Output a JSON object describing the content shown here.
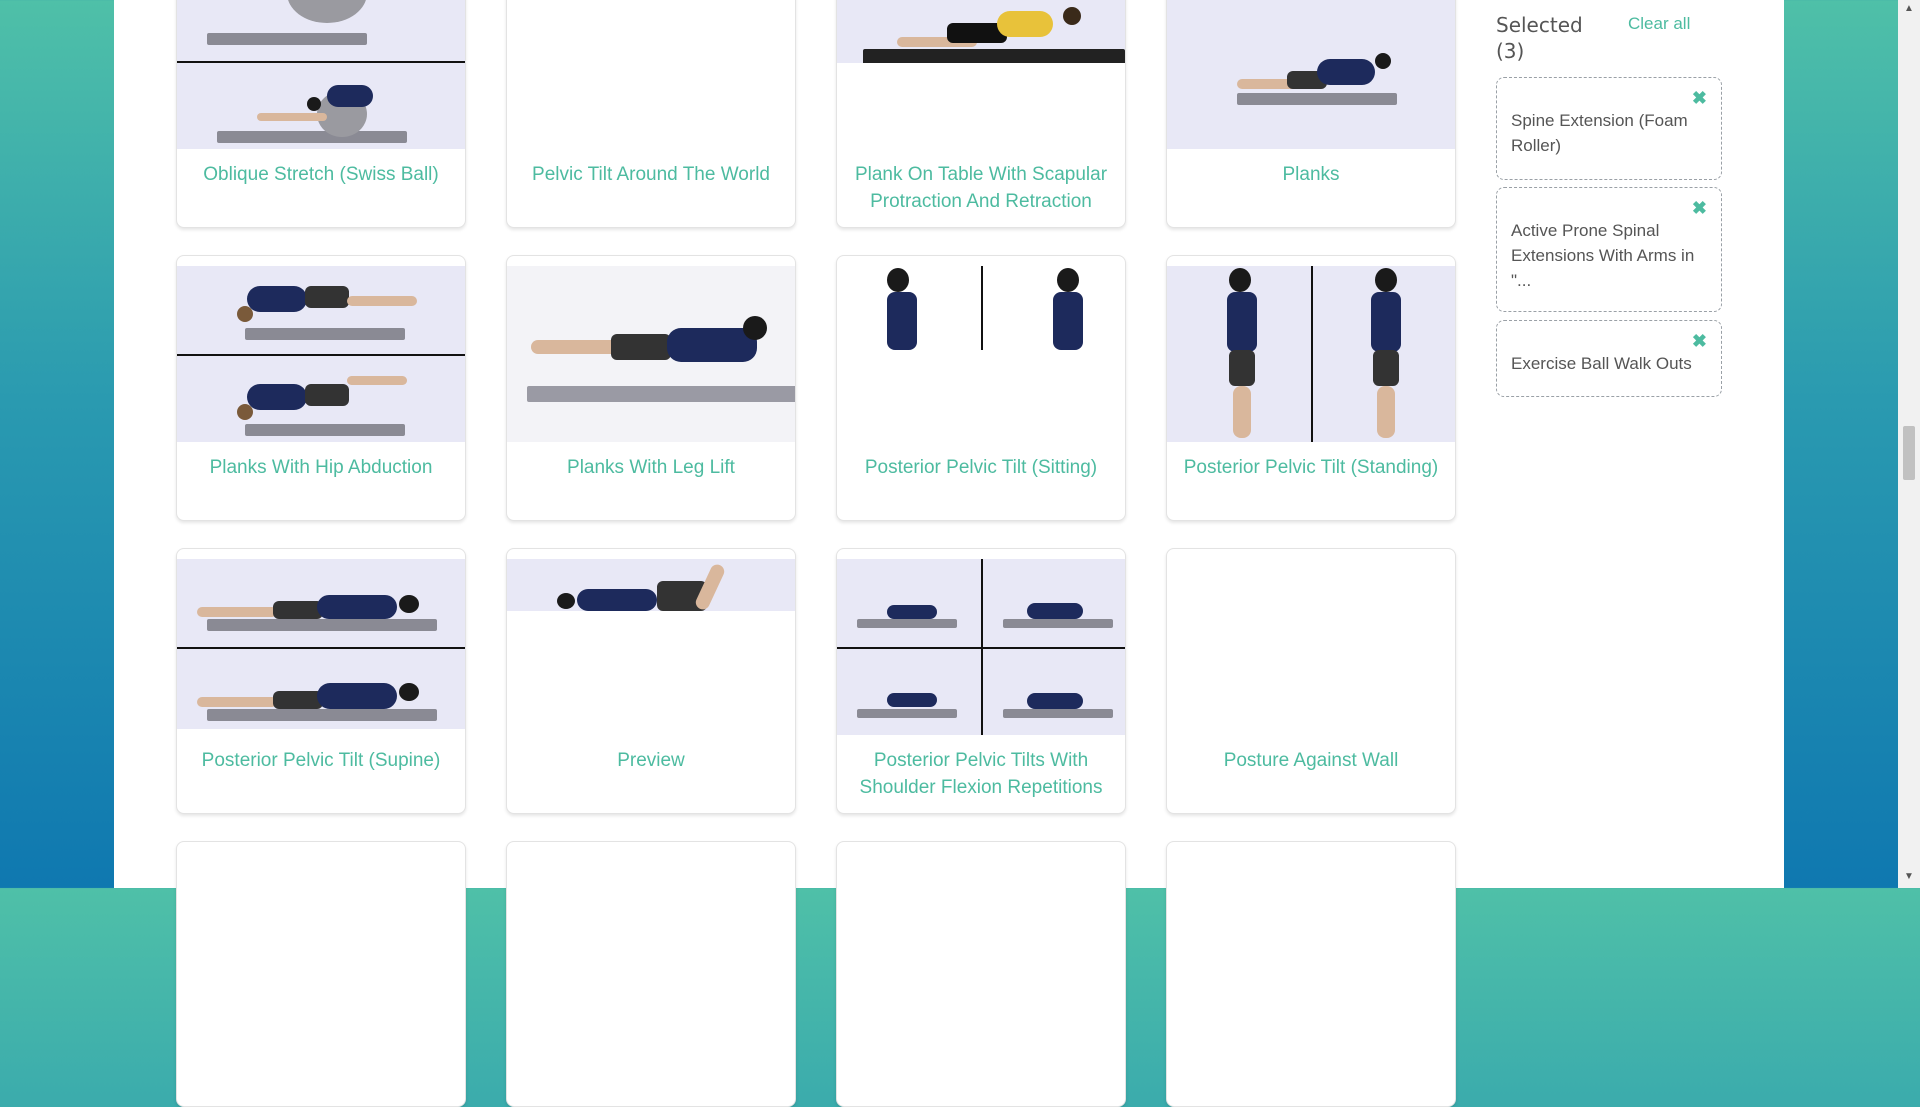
{
  "cards": [
    {
      "title": "Oblique Stretch (Swiss Ball)"
    },
    {
      "title": "Pelvic Tilt Around The World"
    },
    {
      "title": "Plank On Table With Scapular Protraction And Retraction"
    },
    {
      "title": "Planks"
    },
    {
      "title": "Planks With Hip Abduction"
    },
    {
      "title": "Planks With Leg Lift"
    },
    {
      "title": "Posterior Pelvic Tilt (Sitting)"
    },
    {
      "title": "Posterior Pelvic Tilt (Standing)"
    },
    {
      "title": "Posterior Pelvic Tilt (Supine)"
    },
    {
      "title": "Preview"
    },
    {
      "title": "Posterior Pelvic Tilts With Shoulder Flexion Repetitions"
    },
    {
      "title": "Posture Against Wall"
    }
  ],
  "sidebar": {
    "title": "Selected (3)",
    "clear_label": "Clear all",
    "remove_icon": "✖",
    "items": [
      {
        "label": "Spine Extension (Foam Roller)"
      },
      {
        "label": "Active Prone Spinal Extensions With Arms in \"..."
      },
      {
        "label": "Exercise Ball Walk Outs"
      }
    ]
  },
  "colors": {
    "accent": "#4dbba0",
    "text": "#555555"
  }
}
